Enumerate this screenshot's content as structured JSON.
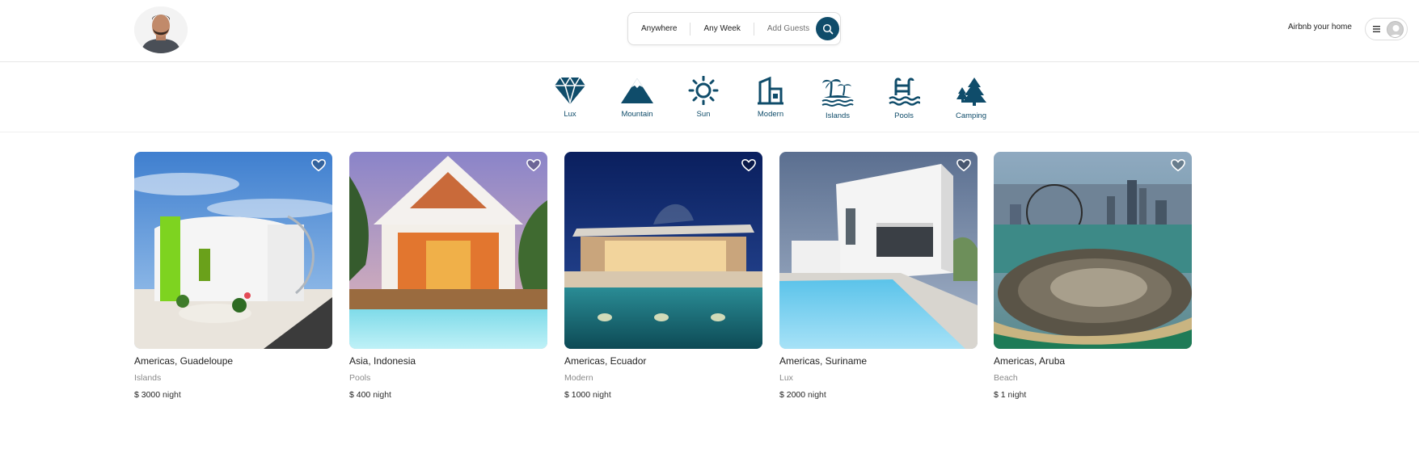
{
  "colors": {
    "brand": "#0f4c6a",
    "border": "#dddddd",
    "muted": "#8a8a8a"
  },
  "header": {
    "logo_icon": "profile-photo",
    "search": {
      "where": "Anywhere",
      "when": "Any Week",
      "guests": "Add Guests",
      "button_icon": "search-icon"
    },
    "host_link": "Airbnb your home",
    "user_menu_icons": [
      "hamburger-icon",
      "user-avatar-icon"
    ]
  },
  "categories": [
    {
      "label": "Lux",
      "icon": "diamond-icon"
    },
    {
      "label": "Mountain",
      "icon": "mountain-icon"
    },
    {
      "label": "Sun",
      "icon": "sun-icon"
    },
    {
      "label": "Modern",
      "icon": "modern-building-icon"
    },
    {
      "label": "Islands",
      "icon": "palm-island-icon"
    },
    {
      "label": "Pools",
      "icon": "pool-ladder-icon"
    },
    {
      "label": "Camping",
      "icon": "pine-trees-icon"
    }
  ],
  "listings": [
    {
      "location": "Americas, Guadeloupe",
      "category": "Islands",
      "price": "$ 3000",
      "per": "night"
    },
    {
      "location": "Asia, Indonesia",
      "category": "Pools",
      "price": "$ 400",
      "per": "night"
    },
    {
      "location": "Americas, Ecuador",
      "category": "Modern",
      "price": "$ 1000",
      "per": "night"
    },
    {
      "location": "Americas, Suriname",
      "category": "Lux",
      "price": "$ 2000",
      "per": "night"
    },
    {
      "location": "Americas, Aruba",
      "category": "Beach",
      "price": "$ 1",
      "per": "night"
    }
  ]
}
